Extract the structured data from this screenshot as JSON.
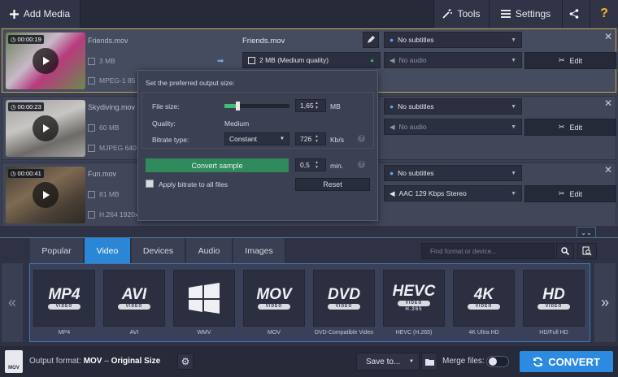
{
  "toolbar": {
    "add_media": "Add Media",
    "tools": "Tools",
    "settings": "Settings"
  },
  "files": [
    {
      "name": "Friends.mov",
      "time": "00:00:19",
      "size": "3 MB",
      "codec": "MPEG-1 85",
      "output_name": "Friends.mov",
      "output_size": "2 MB (Medium quality)",
      "subtitles": "No subtitles",
      "audio": "No audio",
      "edit": "Edit"
    },
    {
      "name": "Skydiving.mov",
      "time": "00:00:23",
      "size": "60 MB",
      "codec": "MJPEG 640",
      "subtitles": "No subtitles",
      "audio": "No audio",
      "edit": "Edit"
    },
    {
      "name": "Fun.mov",
      "time": "00:00:41",
      "size": "81 MB",
      "codec": "H.264 1920x1080 16117 Kbps",
      "subtitles": "No subtitles",
      "audio": "AAC 129 Kbps Stereo",
      "edit": "Edit"
    }
  ],
  "popup": {
    "heading": "Set the preferred output size:",
    "file_size_label": "File size:",
    "file_size_value": "1,65",
    "file_size_unit": "MB",
    "slider_level": 0.2,
    "quality_label": "Quality:",
    "quality_value": "Medium",
    "bitrate_label": "Bitrate type:",
    "bitrate_type": "Constant",
    "bitrate_value": "726",
    "bitrate_unit": "Kb/s",
    "convert_sample": "Convert sample",
    "sample_value": "0,5",
    "sample_unit": "min.",
    "apply_all": "Apply bitrate to all files",
    "reset": "Reset"
  },
  "tabs": [
    "Popular",
    "Video",
    "Devices",
    "Audio",
    "Images"
  ],
  "active_tab": "Video",
  "search_placeholder": "Find format or device...",
  "formats": [
    {
      "logo": "MP4",
      "tag": "VIDEO",
      "label": "MP4"
    },
    {
      "logo": "AVI",
      "tag": "VIDEO",
      "label": "AVI"
    },
    {
      "logo": "",
      "tag": "",
      "label": "WMV",
      "icon": "windows-logo"
    },
    {
      "logo": "MOV",
      "tag": "VIDEO",
      "label": "MOV"
    },
    {
      "logo": "DVD",
      "tag": "VIDEO",
      "label": "DVD-Compatible Video"
    },
    {
      "logo": "HEVC",
      "tag": "VIDEO",
      "tag2": "H.265",
      "label": "HEVC (H.265)"
    },
    {
      "logo": "4K",
      "tag": "VIDEO",
      "label": "4K Ultra HD"
    },
    {
      "logo": "HD",
      "tag": "VIDEO",
      "label": "HD/Full HD"
    }
  ],
  "footer": {
    "output_label": "Output format:",
    "output_format": "MOV",
    "output_sep": "–",
    "output_preset": "Original Size",
    "save_to": "Save to...",
    "merge_files": "Merge files:",
    "convert": "CONVERT"
  },
  "colors": {
    "accent": "#2b86d6",
    "convert": "#2c8be0",
    "green": "#2f8a5c",
    "selected_border": "#c7a64a"
  }
}
